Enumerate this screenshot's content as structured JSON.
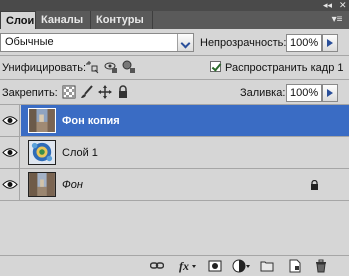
{
  "panel": {
    "collapse_glyph": "◂◂",
    "close_glyph": "✕",
    "menu_glyph": "▾≡"
  },
  "tabs": [
    {
      "label": "Слои",
      "active": true
    },
    {
      "label": "Каналы",
      "active": false
    },
    {
      "label": "Контуры",
      "active": false
    }
  ],
  "blend_mode": {
    "value": "Обычные"
  },
  "opacity": {
    "label": "Непрозрачность:",
    "value": "100%"
  },
  "unify": {
    "label": "Унифицировать:",
    "icons": [
      "unify-position-icon",
      "unify-visibility-icon",
      "unify-style-icon"
    ]
  },
  "propagate": {
    "label": "Распространить кадр 1",
    "checked": true
  },
  "lock": {
    "label": "Закрепить:",
    "icons": [
      "lock-transparent-pixels-icon",
      "lock-image-pixels-icon",
      "lock-position-icon",
      "lock-all-icon"
    ]
  },
  "fill": {
    "label": "Заливка:",
    "value": "100%"
  },
  "layers": [
    {
      "name": "Фон копия",
      "selected": true,
      "italic": false,
      "locked": false,
      "thumb": "street-photo"
    },
    {
      "name": "Слой 1",
      "selected": false,
      "italic": false,
      "locked": false,
      "thumb": "blue-ornament"
    },
    {
      "name": "Фон",
      "selected": false,
      "italic": true,
      "locked": true,
      "thumb": "street-photo"
    }
  ],
  "bottom_icons": [
    "link-layers-icon",
    "layer-style-fx-icon",
    "layer-mask-icon",
    "adjustment-layer-icon",
    "new-group-folder-icon",
    "new-layer-icon",
    "delete-trash-icon"
  ],
  "colors": {
    "selection": "#3a6cc4",
    "panel_bg": "#d6d6d6",
    "tabbar_bg": "#5a5a5a",
    "accent_arrow": "#2a4f9a"
  }
}
